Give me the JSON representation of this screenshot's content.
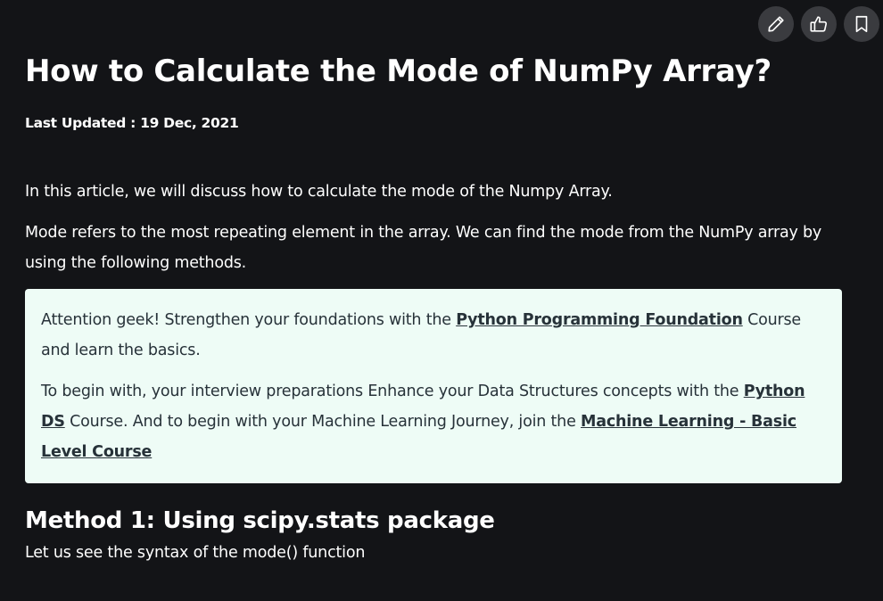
{
  "actions": {
    "edit_icon": "pencil-icon",
    "like_icon": "thumbs-up-icon",
    "bookmark_icon": "bookmark-icon"
  },
  "article": {
    "title": "How to Calculate the Mode of NumPy Array?",
    "last_updated": "Last Updated : 19 Dec, 2021",
    "intro": "In this article, we will discuss how to calculate the mode of the Numpy Array.",
    "description": "Mode refers to the most repeating element in the array. We can find the mode from the NumPy array by using the following methods."
  },
  "callout": {
    "line1_prefix": " Attention geek! Strengthen your foundations with the ",
    "link1": "Python Programming Foundation",
    "line1_suffix": " Course and learn the basics.",
    "line2_prefix": "To begin with, your interview preparations Enhance your Data Structures concepts with the ",
    "link2": "Python DS",
    "line2_middle": " Course. And to begin with your Machine Learning Journey, join the ",
    "link3": "Machine Learning - Basic Level Course"
  },
  "method1": {
    "heading": "Method 1: Using scipy.stats package",
    "text": "Let us see the syntax of the mode() function"
  },
  "colors": {
    "background": "#131417",
    "callout_bg": "#eefcf6",
    "callout_text": "#273239",
    "button_bg": "#3a3b3f"
  }
}
